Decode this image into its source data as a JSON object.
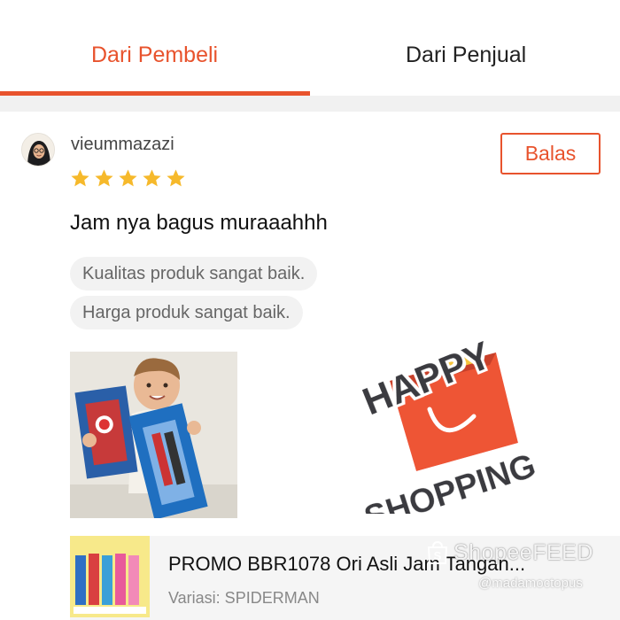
{
  "tabs": {
    "buyer": "Dari Pembeli",
    "seller": "Dari Penjual",
    "active_color": "#e8532d"
  },
  "review": {
    "username": "vieummazazi",
    "rating": 5,
    "rating_max": 5,
    "reply_label": "Balas",
    "text": "Jam nya bagus muraaahhh",
    "tags": [
      "Kualitas produk sangat baik.",
      "Harga produk sangat baik."
    ],
    "star_color": "#f6b92b"
  },
  "sticker": {
    "line1": "HAPPY",
    "line2": "SHOPPING",
    "bag_color": "#ee5534",
    "text_color": "#3a3a40"
  },
  "product": {
    "title": "PROMO BBR1078 Ori Asli Jam Tangan...",
    "variant": "Variasi: SPIDERMAN"
  },
  "watermark": {
    "brand": "ShopeeFEED",
    "handle": "@madamoctopus"
  }
}
